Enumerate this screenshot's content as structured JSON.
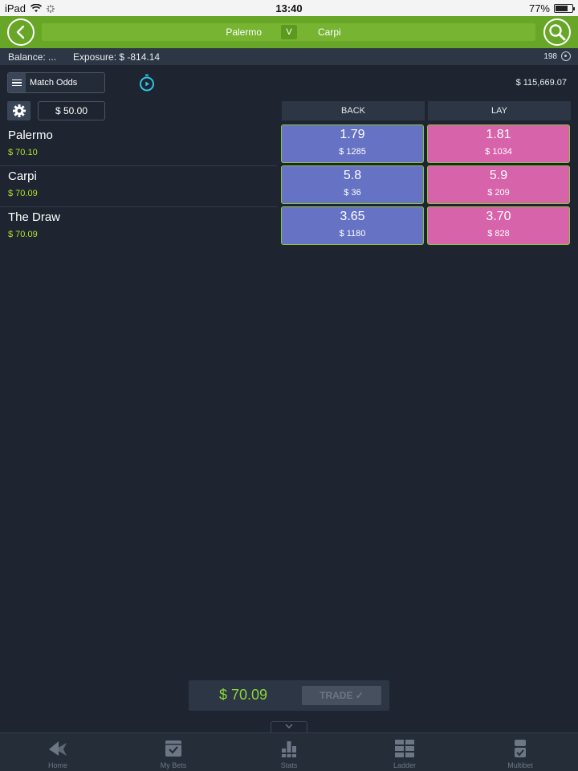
{
  "status_bar": {
    "device": "iPad",
    "time": "13:40",
    "battery": "77%",
    "battery_level": 0.77
  },
  "header": {
    "home_team": "Palermo",
    "vs": "V",
    "away_team": "Carpi"
  },
  "info_bar": {
    "balance": "Balance:  ...",
    "exposure": "Exposure:  $ -814.14",
    "count": "198"
  },
  "market": {
    "name": "Match Odds",
    "total_matched": "$ 115,669.07",
    "stake": "$ 50.00",
    "back_label": "BACK",
    "lay_label": "LAY"
  },
  "runners": [
    {
      "name": "Palermo",
      "pl": "$ 70.10",
      "back_odds": "1.79",
      "back_size": "$ 1285",
      "lay_odds": "1.81",
      "lay_size": "$ 1034"
    },
    {
      "name": "Carpi",
      "pl": "$ 70.09",
      "back_odds": "5.8",
      "back_size": "$ 36",
      "lay_odds": "5.9",
      "lay_size": "$ 209"
    },
    {
      "name": "The Draw",
      "pl": "$ 70.09",
      "back_odds": "3.65",
      "back_size": "$ 1180",
      "lay_odds": "3.70",
      "lay_size": "$ 828"
    }
  ],
  "trade_bar": {
    "amount": "$ 70.09",
    "button_label": "TRADE ✓"
  },
  "tabs": [
    {
      "label": "Home",
      "icon": "home-icon"
    },
    {
      "label": "My Bets",
      "icon": "my-bets-icon"
    },
    {
      "label": "Stats",
      "icon": "stats-icon"
    },
    {
      "label": "Ladder",
      "icon": "ladder-icon"
    },
    {
      "label": "Multibet",
      "icon": "multibet-icon"
    }
  ],
  "colors": {
    "header_green": "#67a626",
    "back_blue": "#6672c4",
    "lay_pink": "#d763aa",
    "profit_green": "#aee22e",
    "background": "#1e2530"
  }
}
